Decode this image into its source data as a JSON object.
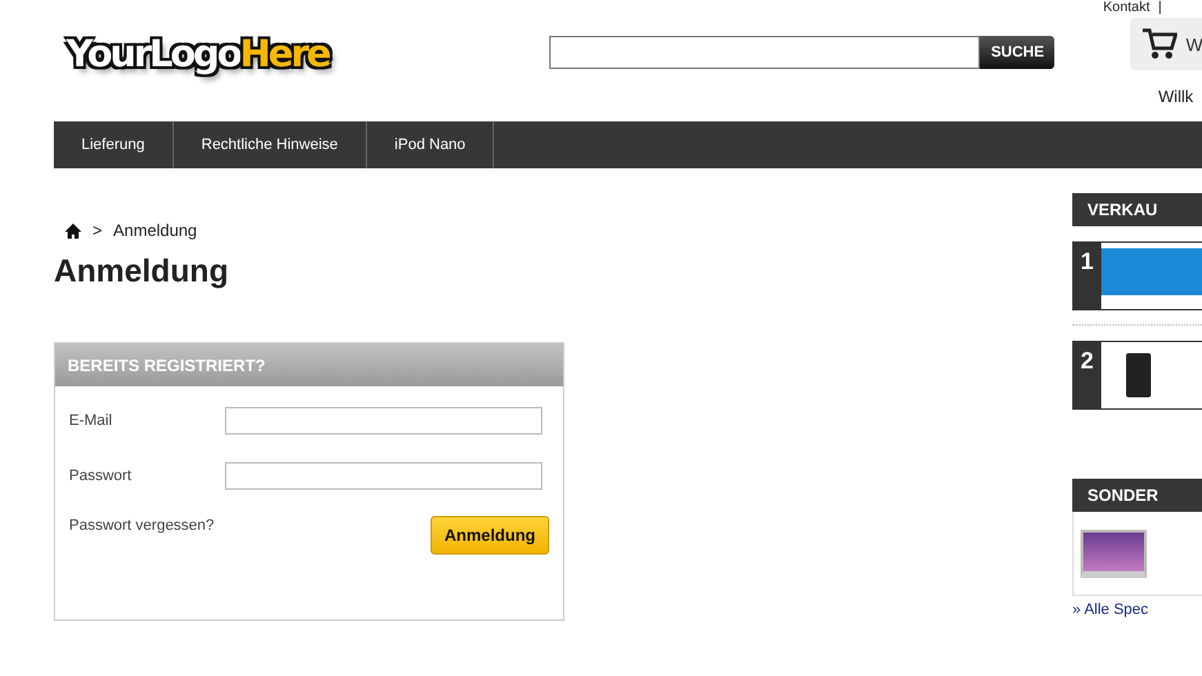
{
  "top_links": [
    "Kontakt",
    "|"
  ],
  "logo": {
    "first": "YourLogo",
    "second": "Here"
  },
  "search": {
    "button": "SUCHE"
  },
  "cart": {
    "label": "W"
  },
  "welcome": "Willk",
  "nav": [
    "Lieferung",
    "Rechtliche Hinweise",
    "iPod Nano"
  ],
  "breadcrumb": {
    "separator": ">",
    "current": "Anmeldung"
  },
  "title": "Anmeldung",
  "login": {
    "heading": "BEREITS REGISTRIERT?",
    "fields": [
      {
        "label": "E-Mail"
      },
      {
        "label": "Passwort"
      }
    ],
    "forgot": "Passwort vergessen?",
    "button": "Anmeldung"
  },
  "bestsellers": {
    "heading": "VERKAU",
    "items": [
      {
        "rank": "1",
        "kind": "player"
      },
      {
        "rank": "2",
        "kind": "phone"
      }
    ]
  },
  "specials": {
    "heading": "SONDER",
    "link": "» Alle Spec"
  }
}
